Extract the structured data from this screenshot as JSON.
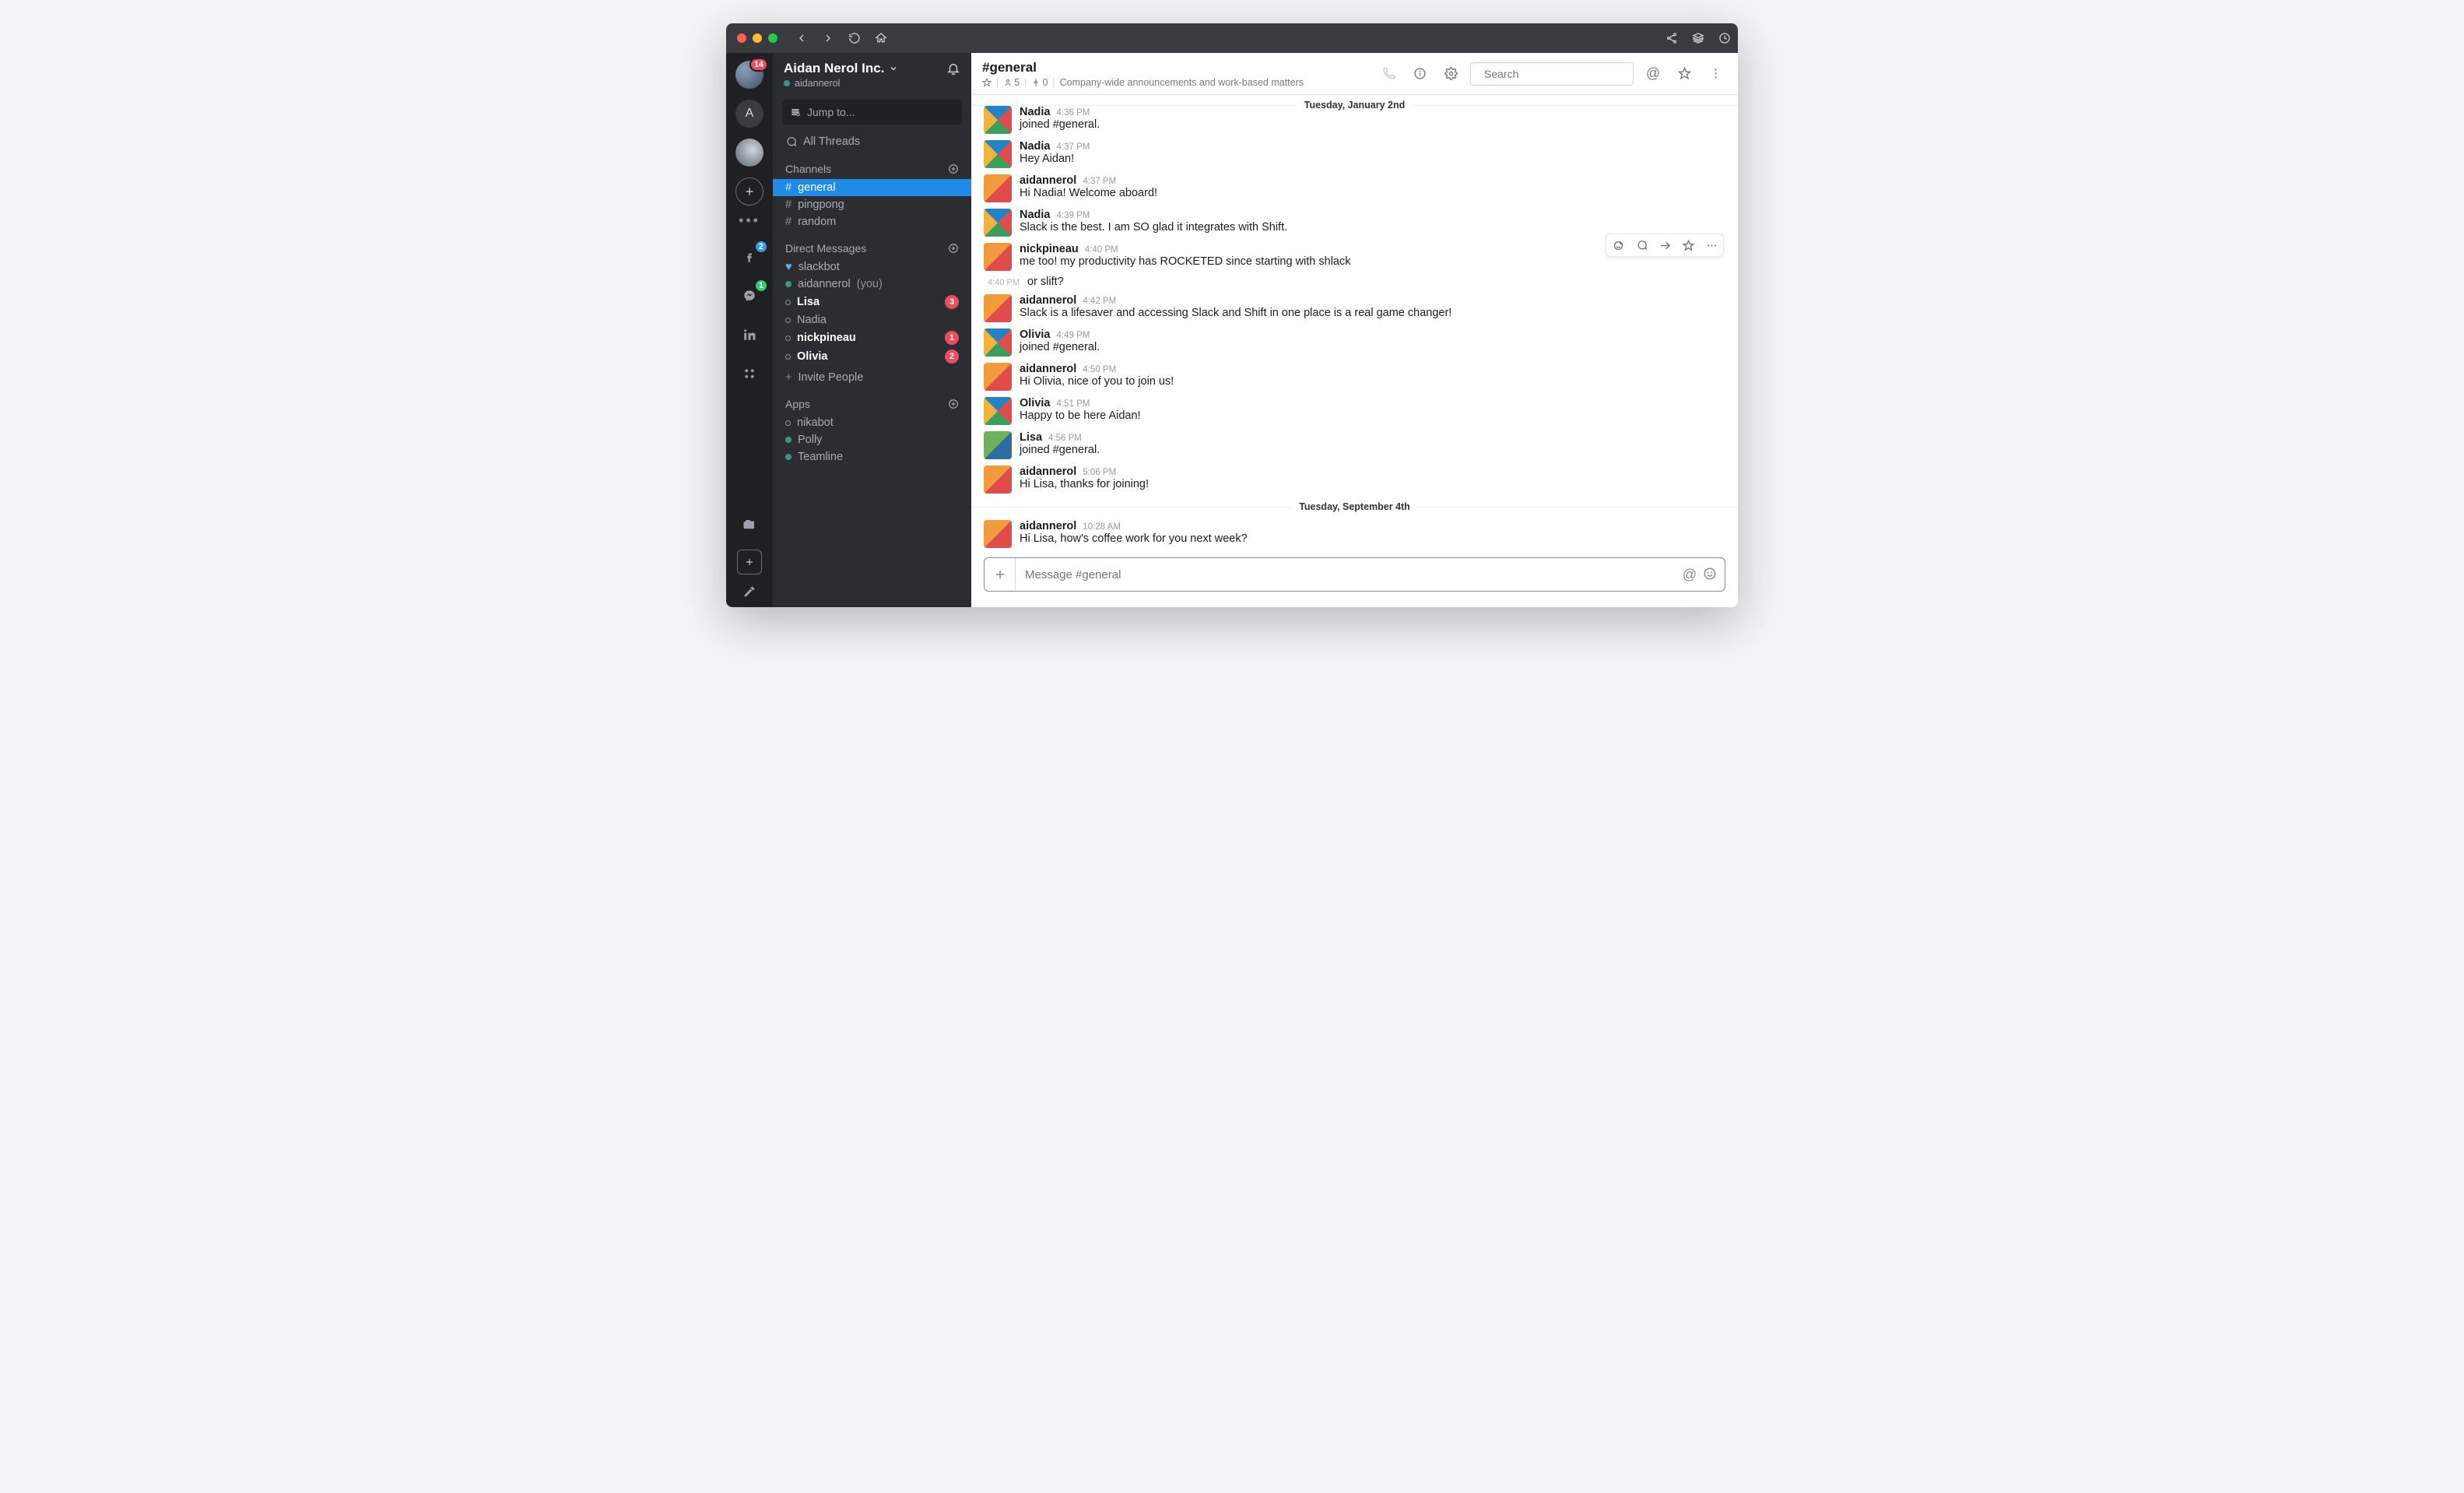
{
  "titlebar": {
    "icons": [
      "back",
      "forward",
      "reload",
      "home",
      "share",
      "stack",
      "history"
    ]
  },
  "rail": {
    "items": [
      {
        "kind": "avatar",
        "badge": "14",
        "badge_color": "red"
      },
      {
        "kind": "letter",
        "letter": "A"
      },
      {
        "kind": "avatar2"
      },
      {
        "kind": "add"
      },
      {
        "kind": "dots"
      },
      {
        "kind": "facebook",
        "badge": "2",
        "badge_color": "blue"
      },
      {
        "kind": "messenger",
        "badge": "1",
        "badge_color": "green"
      },
      {
        "kind": "linkedin"
      },
      {
        "kind": "grid4"
      },
      {
        "kind": "folder"
      }
    ]
  },
  "workspace": {
    "name": "Aidan Nerol Inc.",
    "user": "aidannerol",
    "jump_placeholder": "Jump to...",
    "all_threads": "All Threads"
  },
  "sections": {
    "channels": {
      "title": "Channels",
      "items": [
        {
          "name": "general",
          "active": true
        },
        {
          "name": "pingpong"
        },
        {
          "name": "random"
        }
      ]
    },
    "dm": {
      "title": "Direct Messages",
      "items": [
        {
          "name": "slackbot",
          "icon": "heart",
          "online": true
        },
        {
          "name": "aidannerol",
          "you": "(you)",
          "online": true
        },
        {
          "name": "Lisa",
          "bold": true,
          "away": true,
          "badge": "3"
        },
        {
          "name": "Nadia",
          "away": true
        },
        {
          "name": "nickpineau",
          "bold": true,
          "away": true,
          "badge": "1"
        },
        {
          "name": "Olivia",
          "bold": true,
          "away": true,
          "badge": "2"
        }
      ],
      "invite": "Invite People"
    },
    "apps": {
      "title": "Apps",
      "items": [
        {
          "name": "nikabot",
          "away": true
        },
        {
          "name": "Polly",
          "online": true
        },
        {
          "name": "Teamline",
          "online": true
        }
      ]
    }
  },
  "channel": {
    "title": "#general",
    "members": "5",
    "pins": "0",
    "topic": "Company-wide announcements and work-based matters",
    "search_placeholder": "Search"
  },
  "dividers": {
    "d1": "Tuesday, January 2nd",
    "d2": "Tuesday, September 4th"
  },
  "messages": [
    {
      "user": "Nadia",
      "time": "4:36 PM",
      "text": "joined #general.",
      "avatar": "v1",
      "cut": true
    },
    {
      "user": "Nadia",
      "time": "4:37 PM",
      "text": "Hey Aidan!",
      "avatar": "v1"
    },
    {
      "user": "aidannerol",
      "time": "4:37 PM",
      "text": "Hi Nadia! Welcome aboard!",
      "avatar": "v0"
    },
    {
      "user": "Nadia",
      "time": "4:39 PM",
      "text": "Slack is the best. I am SO glad it integrates with Shift.",
      "avatar": "v1"
    },
    {
      "user": "nickpineau",
      "time": "4:40 PM",
      "text": "me too! my productivity has ROCKETED since starting with shlack",
      "avatar": "v0",
      "hover": true
    },
    {
      "followup": true,
      "time": "4:40 PM",
      "text": "or slift?"
    },
    {
      "user": "aidannerol",
      "time": "4:42 PM",
      "text": "Slack is a lifesaver and accessing Slack and Shift in one place is a real game changer!",
      "avatar": "v0"
    },
    {
      "user": "Olivia",
      "time": "4:49 PM",
      "text": "joined #general.",
      "avatar": "v1"
    },
    {
      "user": "aidannerol",
      "time": "4:50 PM",
      "text": "Hi Olivia, nice of you to join us!",
      "avatar": "v0"
    },
    {
      "user": "Olivia",
      "time": "4:51 PM",
      "text": "Happy to be here Aidan!",
      "avatar": "v1"
    },
    {
      "user": "Lisa",
      "time": "4:56 PM",
      "text": "joined #general.",
      "avatar": "v2"
    },
    {
      "user": "aidannerol",
      "time": "5:06 PM",
      "text": "Hi Lisa, thanks for joining!",
      "avatar": "v0"
    }
  ],
  "messages_after": [
    {
      "user": "aidannerol",
      "time": "10:28 AM",
      "text": "Hi Lisa, how's coffee work for you next week?",
      "avatar": "v0"
    }
  ],
  "composer": {
    "placeholder": "Message #general"
  }
}
